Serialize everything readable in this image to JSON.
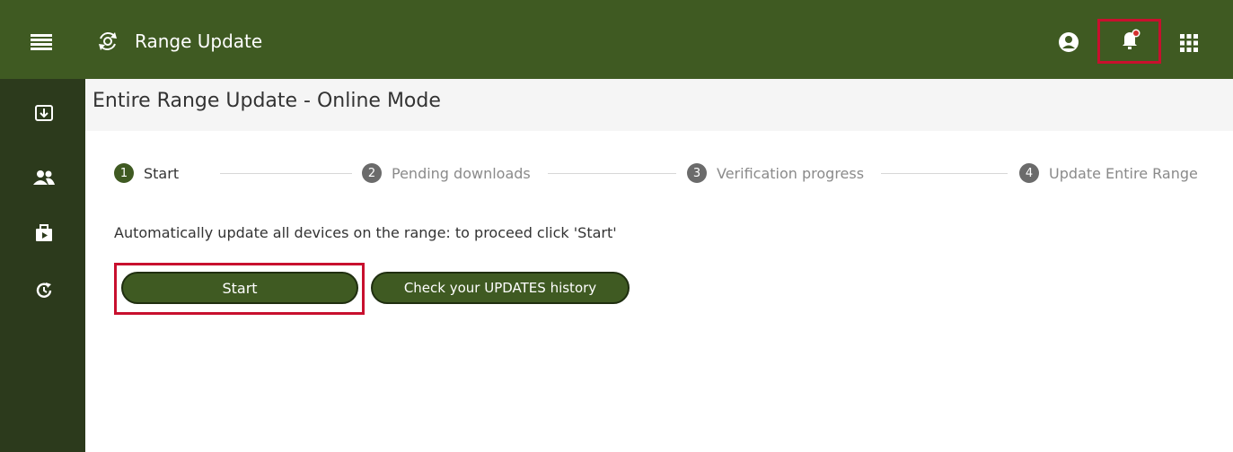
{
  "header": {
    "title": "Range Update",
    "menu_icon": "hamburger-menu-icon",
    "app_icon": "refresh-cycle-icon",
    "account_icon": "account-circle-icon",
    "notifications_icon": "bell-alert-icon",
    "apps_icon": "apps-grid-icon"
  },
  "sidebar": {
    "items": [
      {
        "icon": "download-box-icon"
      },
      {
        "icon": "users-icon"
      },
      {
        "icon": "briefcase-play-icon"
      },
      {
        "icon": "history-refresh-icon"
      }
    ]
  },
  "page": {
    "title": "Entire Range Update - Online Mode"
  },
  "stepper": {
    "steps": [
      {
        "number": "1",
        "label": "Start",
        "active": true
      },
      {
        "number": "2",
        "label": "Pending downloads",
        "active": false
      },
      {
        "number": "3",
        "label": "Verification progress",
        "active": false
      },
      {
        "number": "4",
        "label": "Update Entire Range",
        "active": false
      }
    ]
  },
  "content": {
    "instruction": "Automatically update all devices on the range: to proceed click 'Start'",
    "start_button": "Start",
    "history_button": "Check your UPDATES history"
  },
  "colors": {
    "primary": "#3f5a22",
    "sidebar": "#2c3a1c",
    "highlight": "#c8102e",
    "notification_dot": "#d32f2f"
  }
}
